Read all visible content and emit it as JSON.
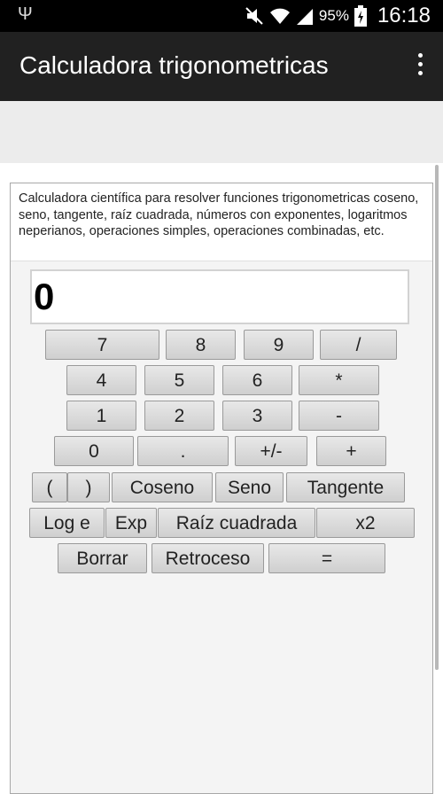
{
  "status_bar": {
    "battery_percent": "95%",
    "time": "16:18",
    "icons": [
      "usb-icon",
      "mute-icon",
      "wifi-icon",
      "signal-icon",
      "battery-charging-icon"
    ]
  },
  "app_bar": {
    "title": "Calculadora trigonometricas",
    "menu_icon": "overflow-menu-icon"
  },
  "description": "Calculadora científica para resolver funciones trigonometricas coseno, seno, tangente, raíz cuadrada, números con exponentes, logaritmos neperianos, operaciones simples, operaciones combinadas, etc.",
  "display": {
    "value": "0"
  },
  "keys": {
    "seven": "7",
    "eight": "8",
    "nine": "9",
    "divide": "/",
    "four": "4",
    "five": "5",
    "six": "6",
    "multiply": "*",
    "one": "1",
    "two": "2",
    "three": "3",
    "minus": "-",
    "zero": "0",
    "dot": ".",
    "sign": "+/-",
    "plus": "+",
    "open_paren": "(",
    "close_paren": ")",
    "cos": "Coseno",
    "sin": "Seno",
    "tan": "Tangente",
    "ln": "Log e",
    "exp": "Exp",
    "sqrt": "Raíz cuadrada",
    "square": "x2",
    "clear": "Borrar",
    "backspace": "Retroceso",
    "equals": "="
  }
}
